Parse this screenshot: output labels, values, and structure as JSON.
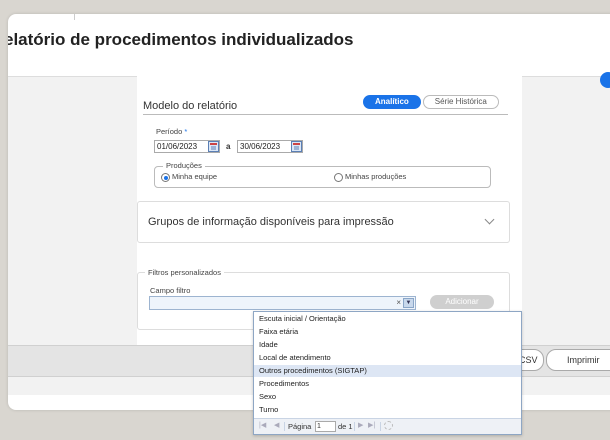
{
  "page": {
    "title": "elatório de procedimentos individualizados"
  },
  "modelo": {
    "title": "Modelo do relatório",
    "toggle": {
      "analitico": "Analítico",
      "serie_historica": "Série Histórica"
    }
  },
  "periodo": {
    "label": "Período",
    "required_mark": "*",
    "start": "01/06/2023",
    "separator": "a",
    "end": "30/06/2023"
  },
  "producoes": {
    "legend": "Produções",
    "option_equipe": "Minha equipe",
    "option_minhas": "Minhas produções",
    "selected": "Minha equipe"
  },
  "grupos": {
    "title": "Grupos de informação disponíveis para impressão"
  },
  "filtros": {
    "legend": "Filtros personalizados",
    "campo_label": "Campo filtro",
    "campo_value": "",
    "clear_symbol": "×",
    "add_button": "Adicionar"
  },
  "dropdown": {
    "items": [
      "Escuta inicial / Orientação",
      "Faixa etária",
      "Idade",
      "Local de atendimento",
      "Outros procedimentos (SIGTAP)",
      "Procedimentos",
      "Sexo",
      "Turno"
    ],
    "highlighted_index": 4,
    "pager": {
      "page_label": "Página",
      "page_value": "1",
      "of_label": "de 1"
    }
  },
  "footer": {
    "csv": "CSV",
    "print": "Imprimir"
  },
  "colors": {
    "accent": "#1a73e8",
    "highlight": "#dde6f4"
  }
}
